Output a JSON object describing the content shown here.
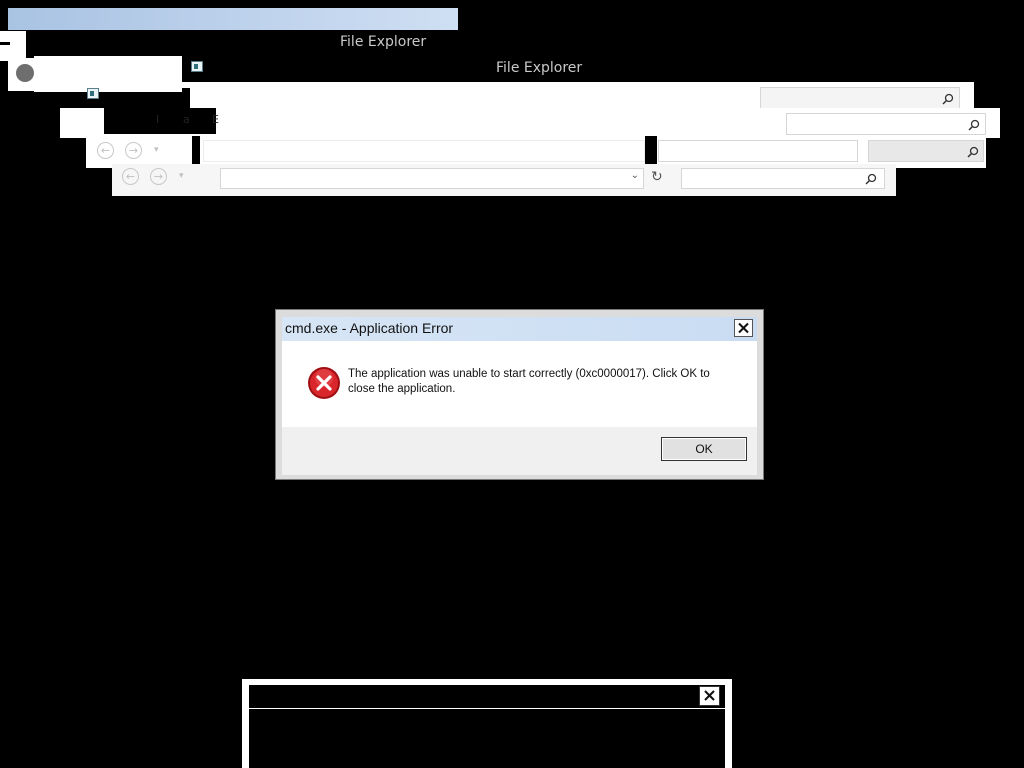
{
  "explorer_ghosts": {
    "title_1": "File Explorer",
    "title_2": "File Explorer",
    "partial_menu": [
      "I",
      "a",
      "E"
    ]
  },
  "icons": {
    "back": "back-arrow-icon",
    "forward": "forward-arrow-icon",
    "recent": "chevron-down-icon",
    "refresh": "refresh-icon",
    "search": "search-icon",
    "error": "error-icon",
    "close": "close-icon"
  },
  "dialog": {
    "title": "cmd.exe - Application Error",
    "message": "The application was unable to start correctly (0xc0000017). Click OK to close the application.",
    "ok_label": "OK"
  },
  "colors": {
    "error_red": "#d8262b",
    "titlebar_blue": "#c9dcf2",
    "background": "#000000"
  }
}
